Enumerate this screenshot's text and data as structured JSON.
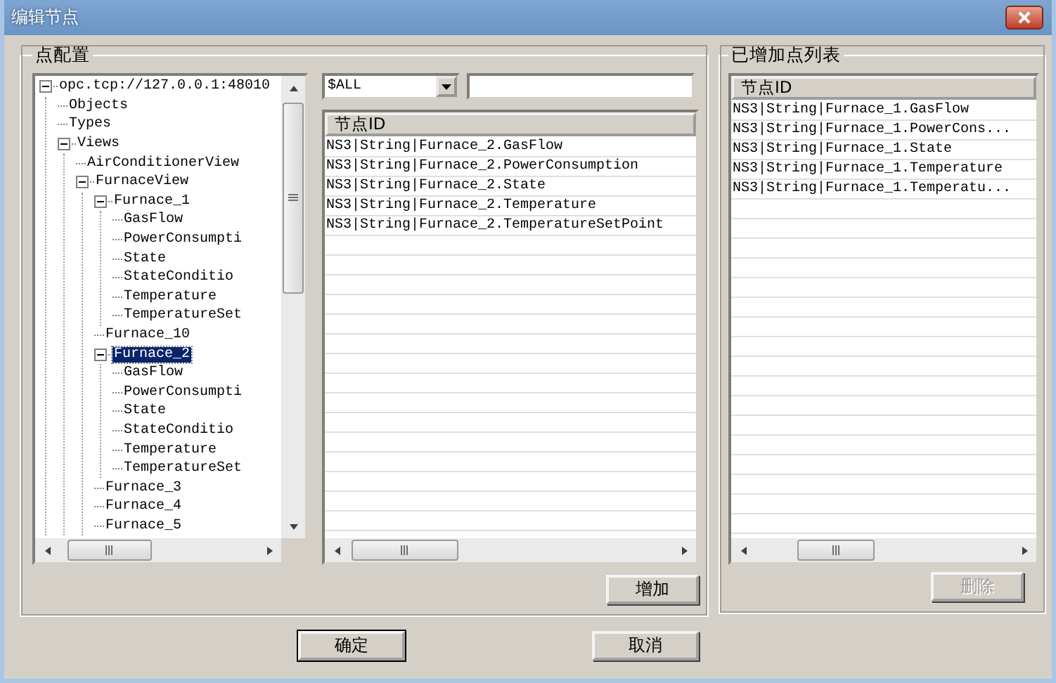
{
  "window": {
    "title": "编辑节点"
  },
  "point_config": {
    "title": "点配置",
    "tree": [
      {
        "label": "opc.tcp://127.0.0.1:48010",
        "expanded": true,
        "selected": false,
        "children": [
          {
            "label": "Objects",
            "selected": false
          },
          {
            "label": "Types",
            "selected": false
          },
          {
            "label": "Views",
            "expanded": true,
            "selected": false,
            "children": [
              {
                "label": "AirConditionerView",
                "selected": false
              },
              {
                "label": "FurnaceView",
                "expanded": true,
                "selected": false,
                "children": [
                  {
                    "label": "Furnace_1",
                    "expanded": true,
                    "selected": false,
                    "children": [
                      {
                        "label": "GasFlow",
                        "selected": false
                      },
                      {
                        "label": "PowerConsumpti",
                        "selected": false
                      },
                      {
                        "label": "State",
                        "selected": false
                      },
                      {
                        "label": "StateConditio",
                        "selected": false
                      },
                      {
                        "label": "Temperature",
                        "selected": false
                      },
                      {
                        "label": "TemperatureSet",
                        "selected": false
                      }
                    ]
                  },
                  {
                    "label": "Furnace_10",
                    "selected": false
                  },
                  {
                    "label": "Furnace_2",
                    "expanded": true,
                    "selected": true,
                    "children": [
                      {
                        "label": "GasFlow",
                        "selected": false
                      },
                      {
                        "label": "PowerConsumpti",
                        "selected": false
                      },
                      {
                        "label": "State",
                        "selected": false
                      },
                      {
                        "label": "StateConditio",
                        "selected": false
                      },
                      {
                        "label": "Temperature",
                        "selected": false
                      },
                      {
                        "label": "TemperatureSet",
                        "selected": false
                      }
                    ]
                  },
                  {
                    "label": "Furnace_3",
                    "selected": false
                  },
                  {
                    "label": "Furnace_4",
                    "selected": false
                  },
                  {
                    "label": "Furnace_5",
                    "selected": false
                  }
                ]
              }
            ]
          }
        ]
      }
    ],
    "filter": {
      "value": "$ALL"
    },
    "table": {
      "columns": [
        "节点ID"
      ],
      "rows": [
        "NS3|String|Furnace_2.GasFlow",
        "NS3|String|Furnace_2.PowerConsumption",
        "NS3|String|Furnace_2.State",
        "NS3|String|Furnace_2.Temperature",
        "NS3|String|Furnace_2.TemperatureSetPoint"
      ]
    },
    "add_button": {
      "label": "增加",
      "disabled": false
    }
  },
  "added_points": {
    "title": "已增加点列表",
    "table": {
      "columns": [
        "节点ID"
      ],
      "rows": [
        "NS3|String|Furnace_1.GasFlow",
        "NS3|String|Furnace_1.PowerCons...",
        "NS3|String|Furnace_1.State",
        "NS3|String|Furnace_1.Temperature",
        "NS3|String|Furnace_1.Temperatu..."
      ]
    },
    "delete_button": {
      "label": "删除",
      "disabled": true
    }
  },
  "buttons": [
    {
      "label": "确定",
      "default": true
    },
    {
      "label": "取消",
      "default": false
    }
  ]
}
